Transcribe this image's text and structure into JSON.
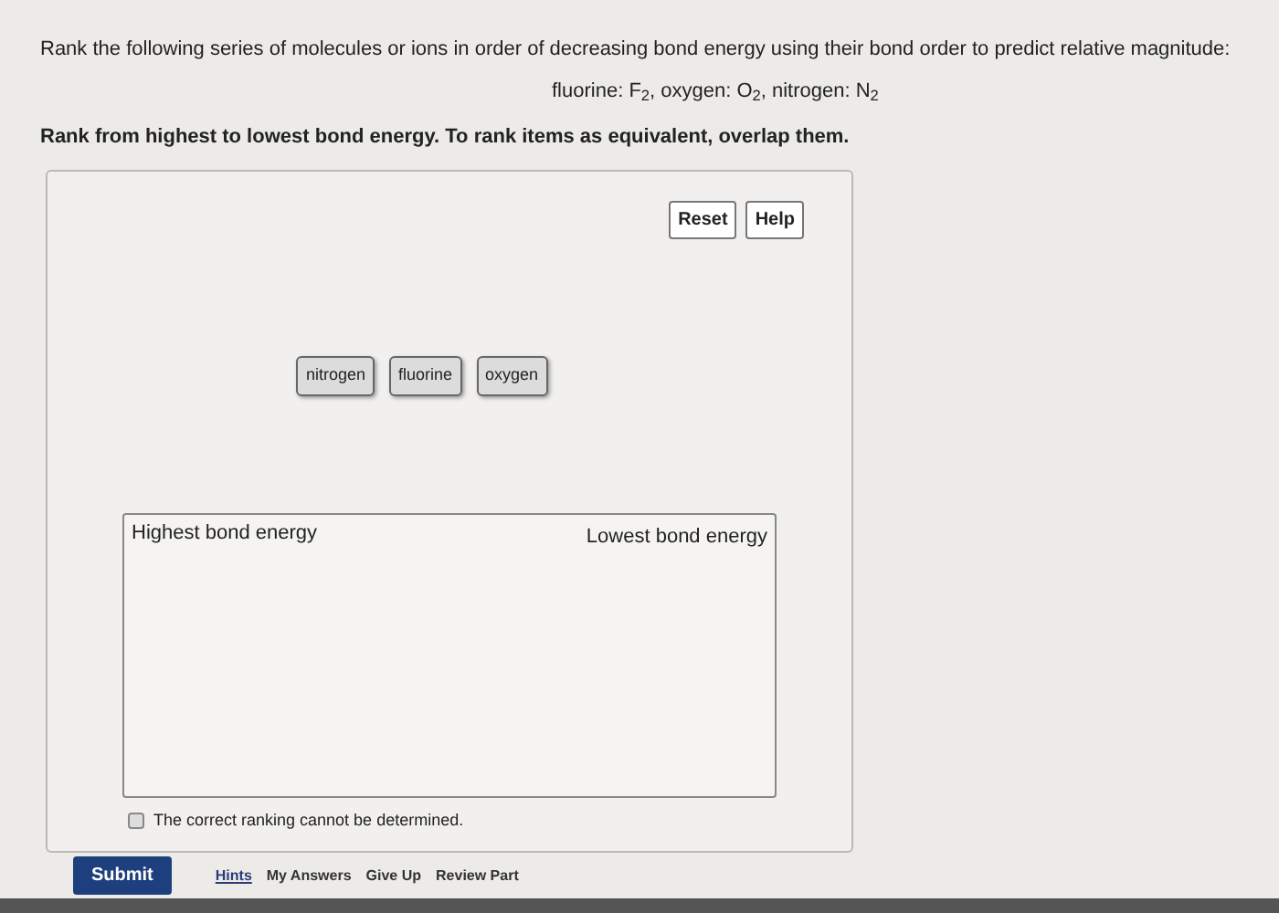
{
  "question": {
    "prompt": "Rank the following series of molecules or ions in order of decreasing bond energy using their bond order to predict relative magnitude:",
    "formula": "fluorine: F$_{2}$, oxygen: O$_{2}$, nitrogen: N$_{2}$",
    "instruction": "Rank from highest to lowest bond energy. To rank items as equivalent, overlap them."
  },
  "panel": {
    "buttons": [
      "Reset",
      "Help"
    ],
    "items": [
      "nitrogen",
      "fluorine",
      "oxygen"
    ],
    "ranking_box": {
      "left_label": "Highest bond energy",
      "right_label": "Lowest bond energy"
    },
    "cannot_determine": {
      "label": "The correct ranking cannot be determined.",
      "checked": false
    }
  },
  "footer": {
    "submit": "Submit",
    "links": [
      {
        "label": "Hints",
        "kind": "link"
      },
      {
        "label": "My Answers",
        "kind": "action"
      },
      {
        "label": "Give Up",
        "kind": "action"
      },
      {
        "label": "Review Part",
        "kind": "action"
      }
    ]
  }
}
